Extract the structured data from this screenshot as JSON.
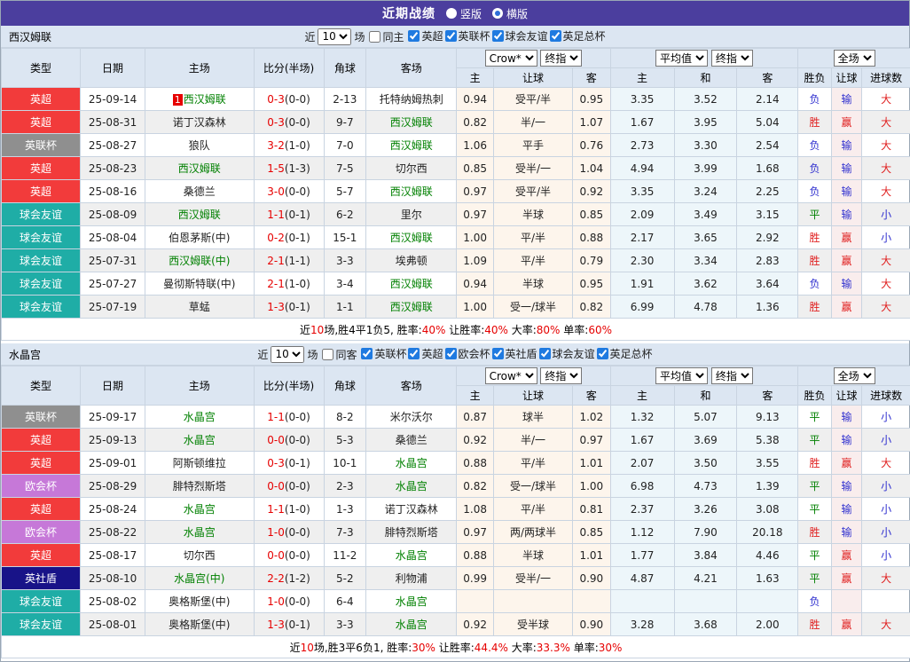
{
  "title_bar": {
    "title": "近期战绩",
    "radios": [
      {
        "label": "竖版",
        "selected": false
      },
      {
        "label": "横版",
        "selected": true
      }
    ]
  },
  "colors": {
    "accent_purple": "#4b3e9e",
    "header_bg": "#dce6f2",
    "focus_team_green": "#008000",
    "score_red": "#e60000",
    "type_badges": {
      "英超": "#f23b3b",
      "英联杯": "#8f8f8f",
      "球会友谊": "#1fada6",
      "欧会杯": "#c678d8",
      "英社盾": "#181388"
    },
    "result_color_map": {
      "胜": "#e02020",
      "赢": "#e02020",
      "大": "#e02020",
      "平": "#008000",
      "负": "#3030cf",
      "输": "#3030cf",
      "小": "#3030cf"
    }
  },
  "table_header": {
    "type": "类型",
    "date": "日期",
    "home": "主场",
    "score": "比分(半场)",
    "corner": "角球",
    "away": "客场",
    "bookmaker_select": "Crow*",
    "final_select_1": "终指",
    "avg_select": "平均值",
    "final_select_2": "终指",
    "scope_select": "全场",
    "sub": {
      "home": "主",
      "handicap": "让球",
      "away": "客",
      "avg_home": "主",
      "avg_draw": "和",
      "avg_away": "客",
      "result": "胜负",
      "handicap_result": "让球",
      "goals": "进球数"
    }
  },
  "filter_common": {
    "near_label": "近",
    "near_value": "10",
    "games_label": "场"
  },
  "sections": [
    {
      "team": "西汉姆联",
      "same_label": "同主",
      "same_checked": false,
      "leagues": [
        "英超",
        "英联杯",
        "球会友谊",
        "英足总杯"
      ],
      "rows": [
        {
          "type": "英超",
          "date": "25-09-14",
          "home": "西汉姆联",
          "home_focus": true,
          "home_mark": "1",
          "score": "0-3",
          "half": "(0-0)",
          "corner": "2-13",
          "away": "托特纳姆热刺",
          "away_focus": false,
          "let_home": "0.94",
          "handicap": "受平/半",
          "let_away": "0.95",
          "avg_home": "3.35",
          "avg_draw": "3.52",
          "avg_away": "2.14",
          "result": "负",
          "handicap_result": "输",
          "goals": "大"
        },
        {
          "type": "英超",
          "date": "25-08-31",
          "home": "诺丁汉森林",
          "home_focus": false,
          "score": "0-3",
          "half": "(0-0)",
          "corner": "9-7",
          "away": "西汉姆联",
          "away_focus": true,
          "let_home": "0.82",
          "handicap": "半/一",
          "let_away": "1.07",
          "avg_home": "1.67",
          "avg_draw": "3.95",
          "avg_away": "5.04",
          "result": "胜",
          "handicap_result": "赢",
          "goals": "大"
        },
        {
          "type": "英联杯",
          "date": "25-08-27",
          "home": "狼队",
          "home_focus": false,
          "score": "3-2",
          "half": "(1-0)",
          "corner": "7-0",
          "away": "西汉姆联",
          "away_focus": true,
          "let_home": "1.06",
          "handicap": "平手",
          "let_away": "0.76",
          "avg_home": "2.73",
          "avg_draw": "3.30",
          "avg_away": "2.54",
          "result": "负",
          "handicap_result": "输",
          "goals": "大"
        },
        {
          "type": "英超",
          "date": "25-08-23",
          "home": "西汉姆联",
          "home_focus": true,
          "score": "1-5",
          "half": "(1-3)",
          "corner": "7-5",
          "away": "切尔西",
          "away_focus": false,
          "let_home": "0.85",
          "handicap": "受半/一",
          "let_away": "1.04",
          "avg_home": "4.94",
          "avg_draw": "3.99",
          "avg_away": "1.68",
          "result": "负",
          "handicap_result": "输",
          "goals": "大"
        },
        {
          "type": "英超",
          "date": "25-08-16",
          "home": "桑德兰",
          "home_focus": false,
          "score": "3-0",
          "half": "(0-0)",
          "corner": "5-7",
          "away": "西汉姆联",
          "away_focus": true,
          "let_home": "0.97",
          "handicap": "受平/半",
          "let_away": "0.92",
          "avg_home": "3.35",
          "avg_draw": "3.24",
          "avg_away": "2.25",
          "result": "负",
          "handicap_result": "输",
          "goals": "大"
        },
        {
          "type": "球会友谊",
          "date": "25-08-09",
          "home": "西汉姆联",
          "home_focus": true,
          "score": "1-1",
          "half": "(0-1)",
          "corner": "6-2",
          "away": "里尔",
          "away_focus": false,
          "let_home": "0.97",
          "handicap": "半球",
          "let_away": "0.85",
          "avg_home": "2.09",
          "avg_draw": "3.49",
          "avg_away": "3.15",
          "result": "平",
          "handicap_result": "输",
          "goals": "小"
        },
        {
          "type": "球会友谊",
          "date": "25-08-04",
          "home": "伯恩茅斯(中)",
          "home_focus": false,
          "score": "0-2",
          "half": "(0-1)",
          "corner": "15-1",
          "away": "西汉姆联",
          "away_focus": true,
          "let_home": "1.00",
          "handicap": "平/半",
          "let_away": "0.88",
          "avg_home": "2.17",
          "avg_draw": "3.65",
          "avg_away": "2.92",
          "result": "胜",
          "handicap_result": "赢",
          "goals": "小"
        },
        {
          "type": "球会友谊",
          "date": "25-07-31",
          "home": "西汉姆联(中)",
          "home_focus": true,
          "score": "2-1",
          "half": "(1-1)",
          "corner": "3-3",
          "away": "埃弗顿",
          "away_focus": false,
          "let_home": "1.09",
          "handicap": "平/半",
          "let_away": "0.79",
          "avg_home": "2.30",
          "avg_draw": "3.34",
          "avg_away": "2.83",
          "result": "胜",
          "handicap_result": "赢",
          "goals": "大"
        },
        {
          "type": "球会友谊",
          "date": "25-07-27",
          "home": "曼彻斯特联(中)",
          "home_focus": false,
          "score": "2-1",
          "half": "(1-0)",
          "corner": "3-4",
          "away": "西汉姆联",
          "away_focus": true,
          "let_home": "0.94",
          "handicap": "半球",
          "let_away": "0.95",
          "avg_home": "1.91",
          "avg_draw": "3.62",
          "avg_away": "3.64",
          "result": "负",
          "handicap_result": "输",
          "goals": "大"
        },
        {
          "type": "球会友谊",
          "date": "25-07-19",
          "home": "草蜢",
          "home_focus": false,
          "score": "1-3",
          "half": "(0-1)",
          "corner": "1-1",
          "away": "西汉姆联",
          "away_focus": true,
          "let_home": "1.00",
          "handicap": "受一/球半",
          "let_away": "0.82",
          "avg_home": "6.99",
          "avg_draw": "4.78",
          "avg_away": "1.36",
          "result": "胜",
          "handicap_result": "赢",
          "goals": "大"
        }
      ],
      "summary": [
        {
          "text": "近",
          "red": false
        },
        {
          "text": "10",
          "red": true
        },
        {
          "text": "场,胜4平1负5, 胜率:",
          "red": false
        },
        {
          "text": "40%",
          "red": true
        },
        {
          "text": " 让胜率:",
          "red": false
        },
        {
          "text": "40%",
          "red": true
        },
        {
          "text": " 大率:",
          "red": false
        },
        {
          "text": "80%",
          "red": true
        },
        {
          "text": " 单率:",
          "red": false
        },
        {
          "text": "60%",
          "red": true
        }
      ]
    },
    {
      "team": "水晶宫",
      "same_label": "同客",
      "same_checked": false,
      "leagues": [
        "英联杯",
        "英超",
        "欧会杯",
        "英社盾",
        "球会友谊",
        "英足总杯"
      ],
      "rows": [
        {
          "type": "英联杯",
          "date": "25-09-17",
          "home": "水晶宫",
          "home_focus": true,
          "score": "1-1",
          "half": "(0-0)",
          "corner": "8-2",
          "away": "米尔沃尔",
          "away_focus": false,
          "let_home": "0.87",
          "handicap": "球半",
          "let_away": "1.02",
          "avg_home": "1.32",
          "avg_draw": "5.07",
          "avg_away": "9.13",
          "result": "平",
          "handicap_result": "输",
          "goals": "小"
        },
        {
          "type": "英超",
          "date": "25-09-13",
          "home": "水晶宫",
          "home_focus": true,
          "score": "0-0",
          "half": "(0-0)",
          "corner": "5-3",
          "away": "桑德兰",
          "away_focus": false,
          "let_home": "0.92",
          "handicap": "半/一",
          "let_away": "0.97",
          "avg_home": "1.67",
          "avg_draw": "3.69",
          "avg_away": "5.38",
          "result": "平",
          "handicap_result": "输",
          "goals": "小"
        },
        {
          "type": "英超",
          "date": "25-09-01",
          "home": "阿斯顿维拉",
          "home_focus": false,
          "score": "0-3",
          "half": "(0-1)",
          "corner": "10-1",
          "away": "水晶宫",
          "away_focus": true,
          "let_home": "0.88",
          "handicap": "平/半",
          "let_away": "1.01",
          "avg_home": "2.07",
          "avg_draw": "3.50",
          "avg_away": "3.55",
          "result": "胜",
          "handicap_result": "赢",
          "goals": "大"
        },
        {
          "type": "欧会杯",
          "date": "25-08-29",
          "home": "腓特烈斯塔",
          "home_focus": false,
          "score": "0-0",
          "half": "(0-0)",
          "corner": "2-3",
          "away": "水晶宫",
          "away_focus": true,
          "let_home": "0.82",
          "handicap": "受一/球半",
          "let_away": "1.00",
          "avg_home": "6.98",
          "avg_draw": "4.73",
          "avg_away": "1.39",
          "result": "平",
          "handicap_result": "输",
          "goals": "小"
        },
        {
          "type": "英超",
          "date": "25-08-24",
          "home": "水晶宫",
          "home_focus": true,
          "score": "1-1",
          "half": "(1-0)",
          "corner": "1-3",
          "away": "诺丁汉森林",
          "away_focus": false,
          "let_home": "1.08",
          "handicap": "平/半",
          "let_away": "0.81",
          "avg_home": "2.37",
          "avg_draw": "3.26",
          "avg_away": "3.08",
          "result": "平",
          "handicap_result": "输",
          "goals": "小"
        },
        {
          "type": "欧会杯",
          "date": "25-08-22",
          "home": "水晶宫",
          "home_focus": true,
          "score": "1-0",
          "half": "(0-0)",
          "corner": "7-3",
          "away": "腓特烈斯塔",
          "away_focus": false,
          "let_home": "0.97",
          "handicap": "两/两球半",
          "let_away": "0.85",
          "avg_home": "1.12",
          "avg_draw": "7.90",
          "avg_away": "20.18",
          "result": "胜",
          "handicap_result": "输",
          "goals": "小"
        },
        {
          "type": "英超",
          "date": "25-08-17",
          "home": "切尔西",
          "home_focus": false,
          "score": "0-0",
          "half": "(0-0)",
          "corner": "11-2",
          "away": "水晶宫",
          "away_focus": true,
          "let_home": "0.88",
          "handicap": "半球",
          "let_away": "1.01",
          "avg_home": "1.77",
          "avg_draw": "3.84",
          "avg_away": "4.46",
          "result": "平",
          "handicap_result": "赢",
          "goals": "小"
        },
        {
          "type": "英社盾",
          "date": "25-08-10",
          "home": "水晶宫(中)",
          "home_focus": true,
          "score": "2-2",
          "half": "(1-2)",
          "corner": "5-2",
          "away": "利物浦",
          "away_focus": false,
          "let_home": "0.99",
          "handicap": "受半/一",
          "let_away": "0.90",
          "avg_home": "4.87",
          "avg_draw": "4.21",
          "avg_away": "1.63",
          "result": "平",
          "handicap_result": "赢",
          "goals": "大"
        },
        {
          "type": "球会友谊",
          "date": "25-08-02",
          "home": "奥格斯堡(中)",
          "home_focus": false,
          "score": "1-0",
          "half": "(0-0)",
          "corner": "6-4",
          "away": "水晶宫",
          "away_focus": true,
          "let_home": "",
          "handicap": "",
          "let_away": "",
          "avg_home": "",
          "avg_draw": "",
          "avg_away": "",
          "result": "负",
          "handicap_result": "",
          "goals": ""
        },
        {
          "type": "球会友谊",
          "date": "25-08-01",
          "home": "奥格斯堡(中)",
          "home_focus": false,
          "score": "1-3",
          "half": "(0-1)",
          "corner": "3-3",
          "away": "水晶宫",
          "away_focus": true,
          "let_home": "0.92",
          "handicap": "受半球",
          "let_away": "0.90",
          "avg_home": "3.28",
          "avg_draw": "3.68",
          "avg_away": "2.00",
          "result": "胜",
          "handicap_result": "赢",
          "goals": "大"
        }
      ],
      "summary": [
        {
          "text": "近",
          "red": false
        },
        {
          "text": "10",
          "red": true
        },
        {
          "text": "场,胜3平6负1, 胜率:",
          "red": false
        },
        {
          "text": "30%",
          "red": true
        },
        {
          "text": " 让胜率:",
          "red": false
        },
        {
          "text": "44.4%",
          "red": true
        },
        {
          "text": " 大率:",
          "red": false
        },
        {
          "text": "33.3%",
          "red": true
        },
        {
          "text": " 单率:",
          "red": false
        },
        {
          "text": "30%",
          "red": true
        }
      ]
    }
  ]
}
